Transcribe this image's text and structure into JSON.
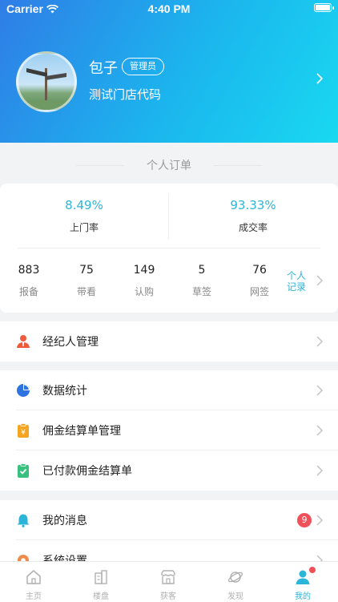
{
  "status_bar": {
    "carrier": "Carrier",
    "time": "4:40 PM"
  },
  "profile": {
    "name": "包子",
    "role": "管理员",
    "store": "测试门店代码"
  },
  "orders": {
    "title": "个人订单",
    "rates": [
      {
        "value": "8.49%",
        "label": "上门率"
      },
      {
        "value": "93.33%",
        "label": "成交率"
      }
    ],
    "stats": [
      {
        "value": "883",
        "label": "报备"
      },
      {
        "value": "75",
        "label": "带看"
      },
      {
        "value": "149",
        "label": "认购"
      },
      {
        "value": "5",
        "label": "草签"
      },
      {
        "value": "76",
        "label": "网签"
      }
    ],
    "record_link": "个人记录"
  },
  "menu": {
    "agent_mgmt": "经纪人管理",
    "data_stats": "数据统计",
    "commission_mgmt": "佣金结算单管理",
    "paid_commission": "已付款佣金结算单",
    "messages": "我的消息",
    "messages_badge": "9",
    "settings": "系统设置"
  },
  "tabbar": {
    "items": [
      {
        "label": "主页",
        "icon": "home-icon"
      },
      {
        "label": "楼盘",
        "icon": "building-icon"
      },
      {
        "label": "获客",
        "icon": "store-icon"
      },
      {
        "label": "发现",
        "icon": "planet-icon"
      },
      {
        "label": "我的",
        "icon": "user-icon"
      }
    ]
  },
  "colors": {
    "accent": "#2bb5d8",
    "badge": "#f0505a",
    "header_start": "#2f7de6",
    "header_end": "#19d9f0"
  }
}
